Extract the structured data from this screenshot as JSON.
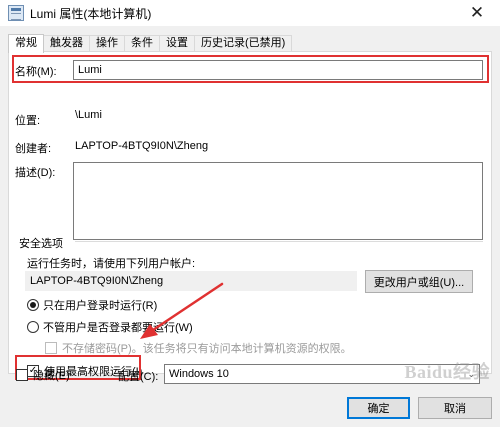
{
  "window": {
    "title": "Lumi 属性(本地计算机)",
    "close_glyph": "✕"
  },
  "tabs": [
    {
      "label": "常规",
      "active": true
    },
    {
      "label": "触发器",
      "active": false
    },
    {
      "label": "操作",
      "active": false
    },
    {
      "label": "条件",
      "active": false
    },
    {
      "label": "设置",
      "active": false
    },
    {
      "label": "历史记录(已禁用)",
      "active": false
    }
  ],
  "general": {
    "name_label": "名称(M):",
    "name_value": "Lumi",
    "location_label": "位置:",
    "location_value": "\\Lumi",
    "author_label": "创建者:",
    "author_value": "LAPTOP-4BTQ9I0N\\Zheng",
    "description_label": "描述(D):",
    "description_value": ""
  },
  "security": {
    "group_label": "安全选项",
    "run_as_label": "运行任务时，请使用下列用户帐户:",
    "run_as_value": "LAPTOP-4BTQ9I0N\\Zheng",
    "change_user_button": "更改用户或组(U)...",
    "radio_logged_on": "只在用户登录时运行(R)",
    "radio_whether": "不管用户是否登录都要运行(W)",
    "no_store_password": "不存储密码(P)。该任务将只有访问本地计算机资源的权限。",
    "highest_privileges": "使用最高权限运行(I)"
  },
  "bottom": {
    "hidden_label": "隐藏(E)",
    "configure_label": "配置(C):",
    "configure_value": "Windows 10",
    "ok_button": "确定",
    "cancel_button": "取消"
  },
  "watermark": "Baidu经验",
  "colors": {
    "highlight": "#e03131",
    "primary_border": "#0078d7"
  }
}
